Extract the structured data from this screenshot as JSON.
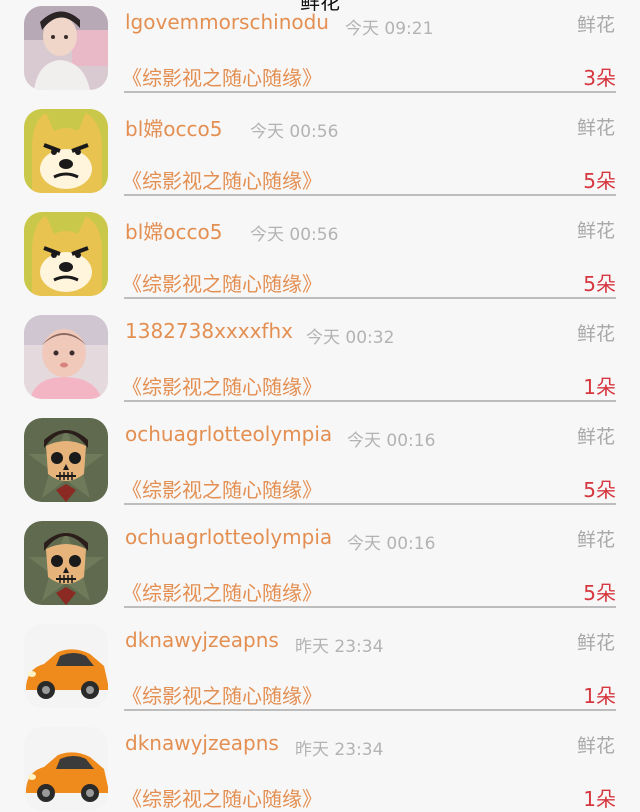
{
  "header": {
    "title": "鲜花"
  },
  "rows": [
    {
      "avatar_icon": "boy-photo-avatar",
      "name": "lgovemmorschinodu",
      "time": "今天 09:21",
      "gift": "鲜花",
      "work": "《综影视之随心随缘》",
      "count": "3朵"
    },
    {
      "avatar_icon": "doge-avatar",
      "name": "bl嫦occo5",
      "time": "今天 00:56",
      "gift": "鲜花",
      "work": "《综影视之随心随缘》",
      "count": "5朵"
    },
    {
      "avatar_icon": "doge-avatar",
      "name": "bl嫦occo5",
      "time": "今天 00:56",
      "gift": "鲜花",
      "work": "《综影视之随心随缘》",
      "count": "5朵"
    },
    {
      "avatar_icon": "baby-photo-avatar",
      "name": "1382738xxxxfhx",
      "time": "今天 00:32",
      "gift": "鲜花",
      "work": "《综影视之随心随缘》",
      "count": "1朵"
    },
    {
      "avatar_icon": "skull-avatar",
      "name": "ochuagrlotteolympia",
      "time": "今天 00:16",
      "gift": "鲜花",
      "work": "《综影视之随心随缘》",
      "count": "5朵"
    },
    {
      "avatar_icon": "skull-avatar",
      "name": "ochuagrlotteolympia",
      "time": "今天 00:16",
      "gift": "鲜花",
      "work": "《综影视之随心随缘》",
      "count": "5朵"
    },
    {
      "avatar_icon": "orange-car-avatar",
      "name": "dknawyjzeapns",
      "time": "昨天 23:34",
      "gift": "鲜花",
      "work": "《综影视之随心随缘》",
      "count": "1朵"
    },
    {
      "avatar_icon": "orange-car-avatar",
      "name": "dknawyjzeapns",
      "time": "昨天 23:34",
      "gift": "鲜花",
      "work": "《综影视之随心随缘》",
      "count": "1朵"
    }
  ],
  "colors": {
    "background": "#f7f7f7",
    "name_text": "#e48f52",
    "time_text": "#b3b3b3",
    "gift_text": "#a9a9a9",
    "count_text": "#d6363f",
    "divider": "#bdbdbd"
  }
}
